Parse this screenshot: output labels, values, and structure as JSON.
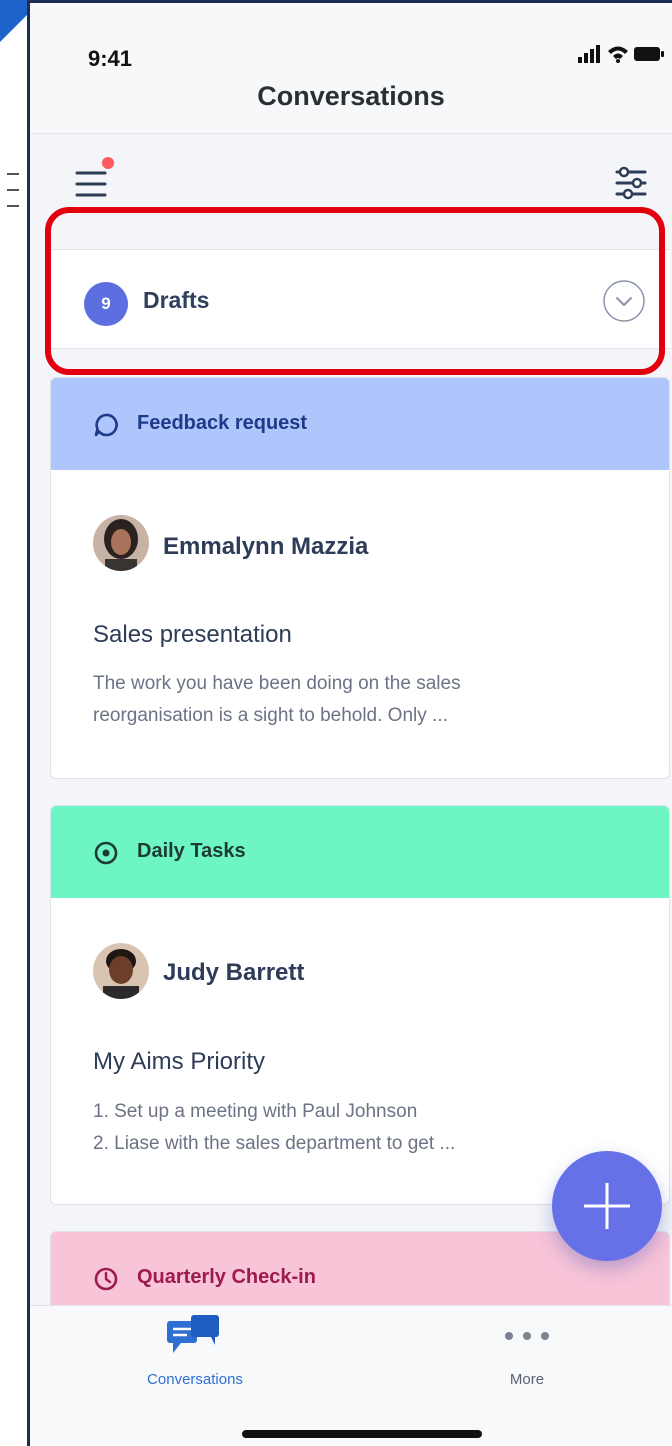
{
  "status": {
    "time": "9:41"
  },
  "header": {
    "title": "Conversations"
  },
  "drafts": {
    "count": "9",
    "label": "Drafts"
  },
  "cards": [
    {
      "header": "Feedback request",
      "header_bg": "#aec6fb",
      "header_color": "#1f3a8a",
      "author": "Emmalynn Mazzia",
      "subject": "Sales presentation",
      "preview_line1": "The work you have been doing on the sales",
      "preview_line2": "reorganisation is a sight to behold. Only ..."
    },
    {
      "header": "Daily Tasks",
      "header_bg": "#6ef5c4",
      "header_color": "#1c3b33",
      "author": "Judy Barrett",
      "subject": "My Aims Priority",
      "preview_line1": "1. Set up a meeting with Paul Johnson",
      "preview_line2": "2. Liase with the sales department to get ..."
    },
    {
      "header": "Quarterly Check-in",
      "header_bg": "#f8c4d8",
      "header_color": "#9d1b4d"
    }
  ],
  "nav": {
    "conversations": "Conversations",
    "more": "More"
  },
  "colors": {
    "accent": "#6671e8",
    "highlight": "#e2000f"
  }
}
